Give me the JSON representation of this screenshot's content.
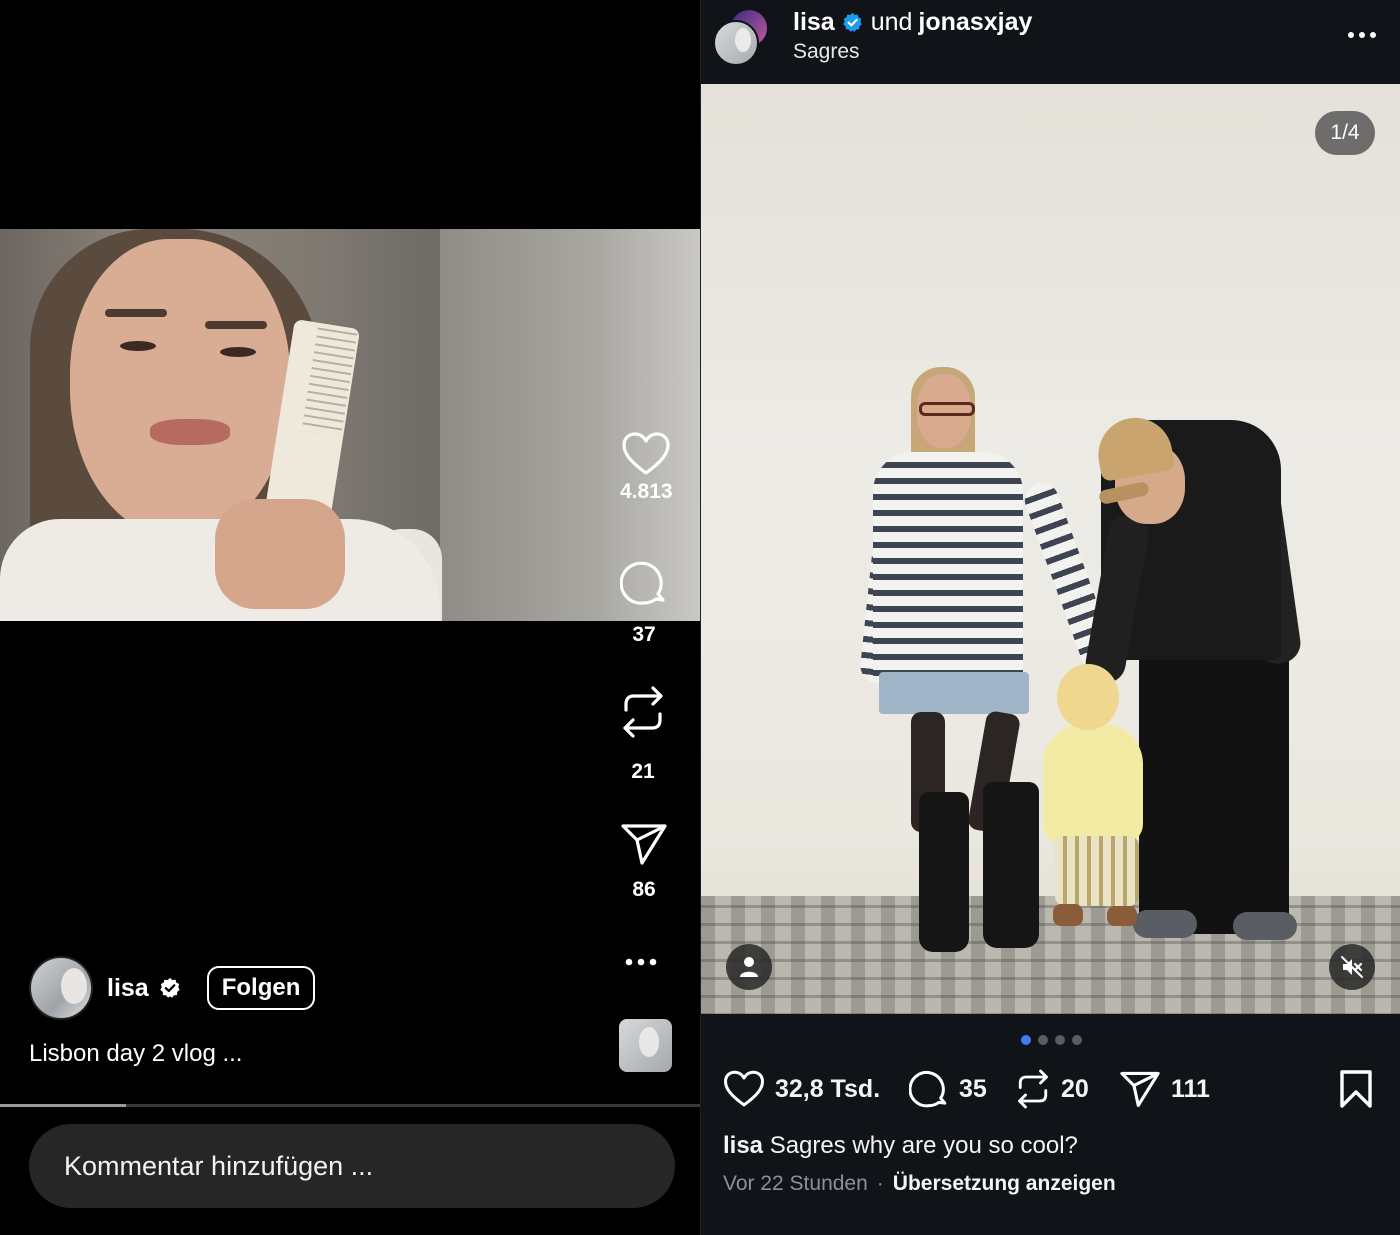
{
  "reel": {
    "like_count": "4.813",
    "comment_count": "37",
    "repost_count": "21",
    "share_count": "86",
    "creator": {
      "username": "lisa",
      "verified": true
    },
    "follow_label": "Folgen",
    "caption": "Lisbon day 2 vlog ...",
    "progress_fraction": 0.18,
    "comment_placeholder": "Kommentar hinzufügen ...",
    "icons": [
      "heart-icon",
      "comment-icon",
      "repost-icon",
      "share-icon",
      "more-icon",
      "verified-badge-icon"
    ]
  },
  "post": {
    "header": {
      "user1": "lisa",
      "joiner": "und",
      "user2": "jonasxjay",
      "location": "Sagres"
    },
    "carousel": {
      "counter": "1/4",
      "total": 4,
      "active_index": 0
    },
    "stats": {
      "likes": "32,8 Tsd.",
      "comments": "35",
      "reposts": "20",
      "shares": "111"
    },
    "caption": {
      "username": "lisa",
      "text": "Sagres why are you so cool?"
    },
    "meta": {
      "time": "Vor 22 Stunden",
      "separator": "·",
      "translate_label": "Übersetzung anzeigen"
    },
    "icons": [
      "more-horizontal-icon",
      "tag-person-icon",
      "muted-speaker-icon",
      "heart-icon",
      "comment-icon",
      "repost-icon",
      "share-icon",
      "bookmark-icon"
    ]
  },
  "colors": {
    "left_bg": "#000000",
    "right_bg": "#101318",
    "accent_blue": "#3f7bf2",
    "verified_blue": "#1d9bf0",
    "input_bg": "#262626"
  }
}
